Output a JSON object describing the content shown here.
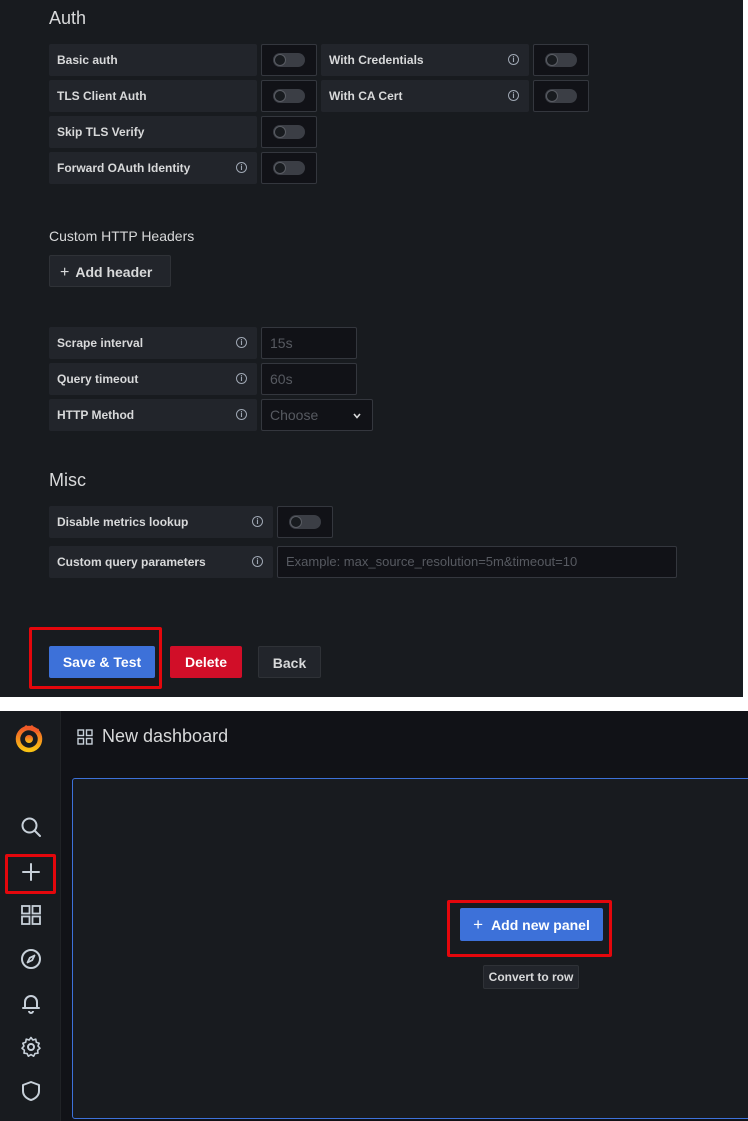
{
  "auth": {
    "title": "Auth",
    "basic_auth": "Basic auth",
    "with_credentials": "With Credentials",
    "tls_client_auth": "TLS Client Auth",
    "with_ca_cert": "With CA Cert",
    "skip_tls_verify": "Skip TLS Verify",
    "forward_oauth": "Forward OAuth Identity"
  },
  "headers": {
    "title": "Custom HTTP Headers",
    "add_label": "Add header"
  },
  "query": {
    "scrape_label": "Scrape interval",
    "scrape_placeholder": "15s",
    "timeout_label": "Query timeout",
    "timeout_placeholder": "60s",
    "method_label": "HTTP Method",
    "method_placeholder": "Choose"
  },
  "misc": {
    "title": "Misc",
    "disable_lookup": "Disable metrics lookup",
    "custom_params": "Custom query parameters",
    "custom_params_placeholder": "Example: max_source_resolution=5m&timeout=10"
  },
  "actions": {
    "save": "Save & Test",
    "delete": "Delete",
    "back": "Back"
  },
  "dashboard": {
    "title": "New dashboard",
    "add_panel": "Add new panel",
    "convert_row": "Convert to row"
  },
  "colors": {
    "primary": "#3d71d9",
    "danger": "#d10e28",
    "highlight": "#e4070c",
    "brand": "#f46800"
  },
  "icons": [
    "grafana-logo-icon",
    "search-icon",
    "plus-icon",
    "dashboards-icon",
    "explore-compass-icon",
    "alert-bell-icon",
    "gear-icon",
    "shield-icon"
  ]
}
